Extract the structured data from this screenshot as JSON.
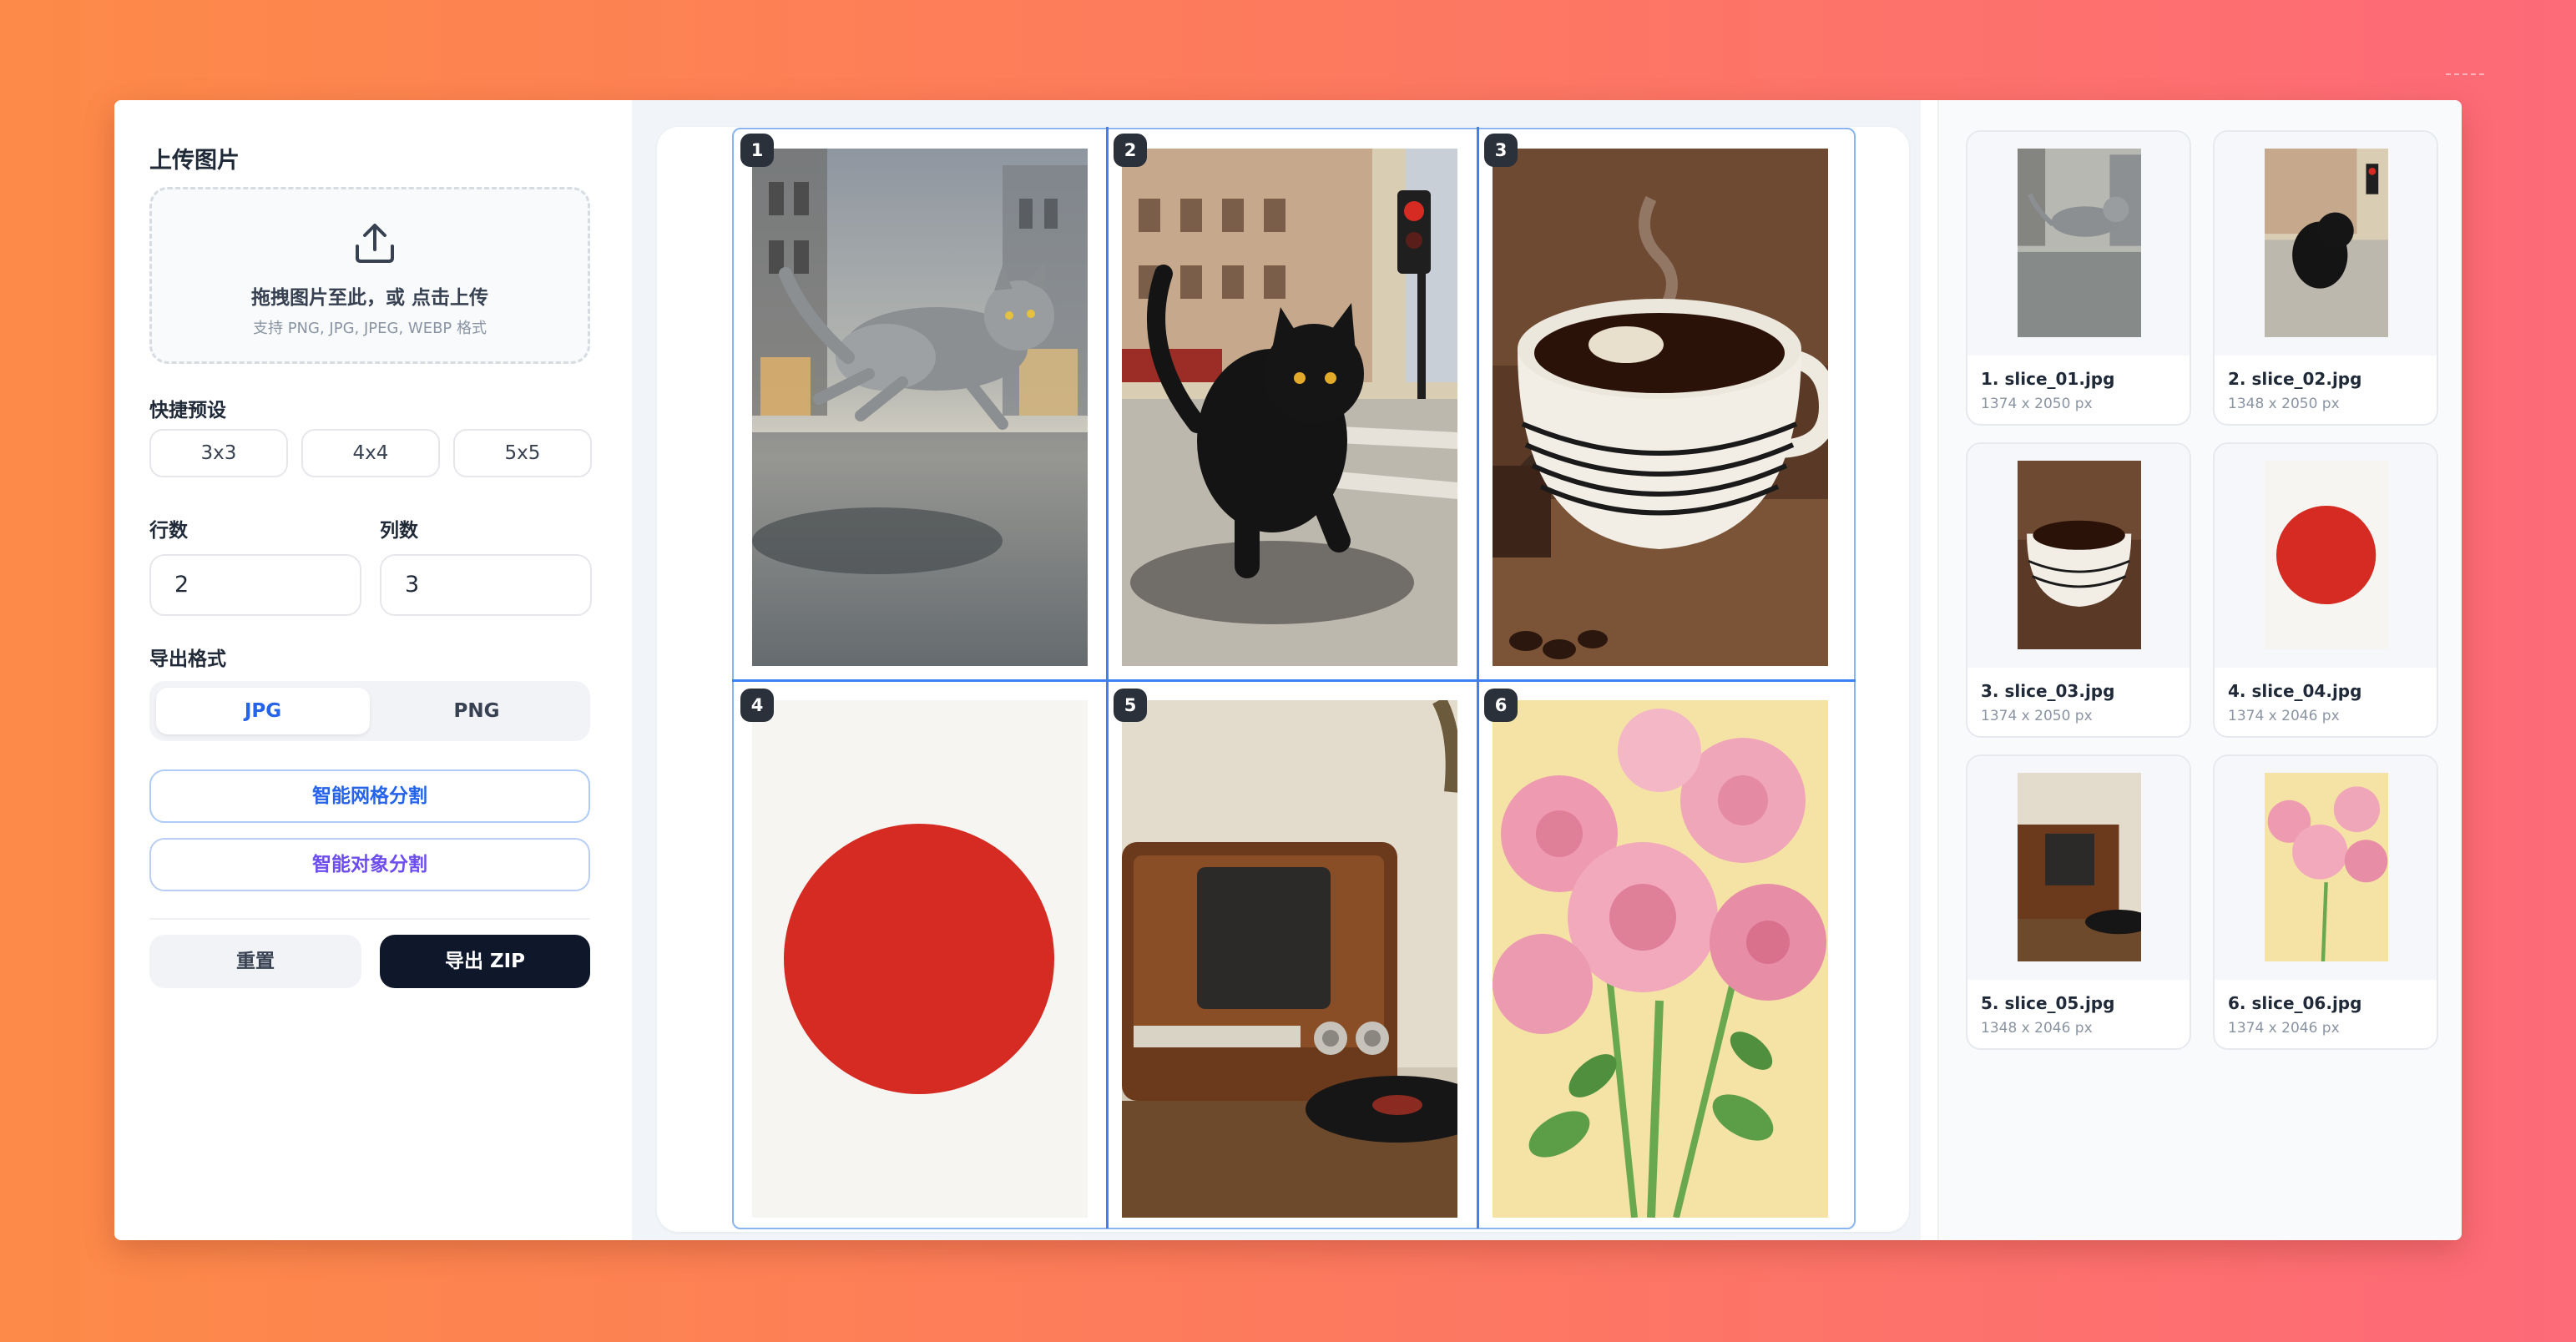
{
  "left_panel": {
    "title": "上传图片",
    "dropzone": {
      "icon": "upload-icon",
      "main_text": "拖拽图片至此，或 点击上传",
      "sub_text": "支持 PNG, JPG, JPEG, WEBP 格式"
    },
    "presets_label": "快捷预设",
    "presets": [
      "3x3",
      "4x4",
      "5x5"
    ],
    "rows_label": "行数",
    "rows_value": "2",
    "cols_label": "列数",
    "cols_value": "3",
    "format_label": "导出格式",
    "formats": [
      "JPG",
      "PNG"
    ],
    "selected_format": "JPG",
    "smart_grid_button": "智能网格分割",
    "smart_object_button": "智能对象分割",
    "reset_button": "重置",
    "export_button": "导出 ZIP"
  },
  "canvas": {
    "rows": 2,
    "cols": 3,
    "cells": [
      {
        "index": "1",
        "content": "watercolor gray cat running on wet street"
      },
      {
        "index": "2",
        "content": "black cat walking on city street"
      },
      {
        "index": "3",
        "content": "cup of black coffee"
      },
      {
        "index": "4",
        "content": "red circle on white"
      },
      {
        "index": "5",
        "content": "vintage wooden radio"
      },
      {
        "index": "6",
        "content": "watercolor pink roses"
      }
    ]
  },
  "slices": [
    {
      "name": "1. slice_01.jpg",
      "dims": "1374 x 2050 px"
    },
    {
      "name": "2. slice_02.jpg",
      "dims": "1348 x 2050 px"
    },
    {
      "name": "3. slice_03.jpg",
      "dims": "1374 x 2050 px"
    },
    {
      "name": "4. slice_04.jpg",
      "dims": "1374 x 2046 px"
    },
    {
      "name": "5. slice_05.jpg",
      "dims": "1348 x 2046 px"
    },
    {
      "name": "6. slice_06.jpg",
      "dims": "1374 x 2046 px"
    }
  ],
  "colors": {
    "accent": "#2563eb",
    "grid_line": "#3b82f6",
    "export_button_bg": "#0f172a",
    "circle_red": "#d52b22"
  }
}
